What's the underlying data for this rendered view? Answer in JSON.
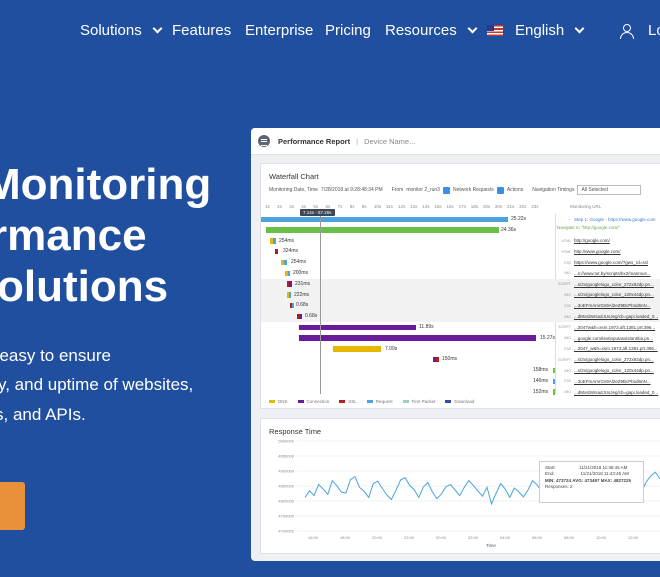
{
  "nav": {
    "items": [
      {
        "label": "Solutions",
        "has_dropdown": true
      },
      {
        "label": "Features",
        "has_dropdown": false
      },
      {
        "label": "Enterprise",
        "has_dropdown": false
      },
      {
        "label": "Pricing",
        "has_dropdown": false
      },
      {
        "label": "Resources",
        "has_dropdown": true
      }
    ],
    "language": "English",
    "login": "Log"
  },
  "hero": {
    "title_lines": [
      "Monitoring",
      "rmance",
      "olutions"
    ],
    "subtitle_lines": [
      "t easy to ensure",
      "y, and uptime of websites,",
      "s, and APIs."
    ]
  },
  "report": {
    "header_title": "Performance Report",
    "header_device": "Device Name...",
    "waterfall": {
      "title": "Waterfall Chart",
      "monitoring_date_label": "Monitoring Date, Time",
      "monitoring_date": "7/28/2018 at 9:28:48:34 PM",
      "from_label": "From",
      "from_value": "monitor 2_run3",
      "network_requests": "Network Requests",
      "actions": "Actions",
      "nav_timings_label": "Navigation Timings",
      "nav_timings_value": "All Selected",
      "monitoring_url_label": "Monitoring URL",
      "tick_labels": [
        "1s",
        "2s",
        "3s",
        "4s",
        "5s",
        "6s",
        "7s",
        "8s",
        "9s",
        "10s",
        "11s",
        "12s",
        "13s",
        "14s",
        "15s",
        "16s",
        "17s",
        "18s",
        "19s",
        "20s",
        "21s",
        "22s",
        "23s"
      ],
      "cursor_label": "7.14s - 57.26s",
      "rows": [
        {
          "label": "25.22s",
          "type": "",
          "url": "Step 1: Google - https://www.google.com",
          "kind": "step"
        },
        {
          "label": "24.36s",
          "type": "",
          "url": "Navigate to \"http://google.com/\"",
          "kind": "nav"
        },
        {
          "label": "254ms",
          "type": "HTML",
          "url": "http://google.com/",
          "kind": "url"
        },
        {
          "label": "324ms",
          "type": "HTML",
          "url": "http://www.google.com/",
          "kind": "url"
        },
        {
          "label": "254ms",
          "type": "CSS",
          "url": "https://www.google.com/?gws_rd=ssl",
          "kind": "url"
        },
        {
          "label": "200ms",
          "type": "IMG",
          "url": "...s://www.tut.by/scripts/bx2/manmus...",
          "kind": "url"
        },
        {
          "label": "231ms",
          "type": "SCRIPT",
          "url": "...s/2x/googlelogo_color_272x92dp.pn...",
          "kind": "url"
        },
        {
          "label": "222ms",
          "type": "IMG",
          "url": "...s/2x/googlelogo_color_120x44dp.pn...",
          "kind": "url"
        },
        {
          "label": "0.68s",
          "type": "CSS",
          "url": "...3oEFmAmrGs9Al2eZ9BcPbsd6nN...",
          "kind": "url"
        },
        {
          "label": "0.68s",
          "type": "IMG",
          "url": "...dMxsbWsadJUsJeg/cb=gapi.loaded_0...",
          "kind": "url"
        },
        {
          "label": "11.89s",
          "type": "SCRIPT",
          "url": "...2047w&h=xsm.1973.aft.1381.prt.396...",
          "kind": "url"
        },
        {
          "label": "15.27s",
          "type": "IMG",
          "url": "...google.com/textinputassistant/tia.pn...",
          "kind": "url"
        },
        {
          "label": "7.09s",
          "type": "CSS",
          "url": "...2047_w&h=xsm.1973.aft.1381.prt.396...",
          "kind": "url"
        },
        {
          "label": "150ms",
          "type": "SCRIPT",
          "url": "...s/2x/googlelogo_color_272x92dp.pn...",
          "kind": "url"
        },
        {
          "label": "158ms",
          "type": "IMG",
          "url": "...s/2x/googlelogo_color_120x44dp.pn...",
          "kind": "url"
        },
        {
          "label": "146ms",
          "type": "CSS",
          "url": "...3oEFmAmrGs9Al2eZ9BcPbsd6nN...",
          "kind": "url"
        },
        {
          "label": "152ms",
          "type": "IMG",
          "url": "...dMxsbWsadJUsJeg/cb=gapi.loaded_0...",
          "kind": "url"
        }
      ],
      "legend": [
        "DNS",
        "Connection",
        "SSL",
        "Request",
        "First Packet",
        "Download"
      ]
    },
    "response_time": {
      "title": "Response Time",
      "tooltip": {
        "start_label": "Start:",
        "start_value": "11/21/2018 11:38:45 AM",
        "end_label": "End:",
        "end_value": "11/21/2018 11:43:45 AM",
        "min": "MIN: 473724",
        "avg": "AVG: 473497",
        "max": "MAX: 4827225",
        "responses": "Responses: 2"
      }
    }
  },
  "chart_data": {
    "type": "line",
    "title": "Response Time",
    "xlabel": "Time",
    "ylabel": "",
    "x_tick_labels": [
      "16:00",
      "18:00",
      "20:00",
      "22:00",
      "00:00",
      "02:00",
      "04:00",
      "06:00",
      "08:00",
      "10:00",
      "12:00"
    ],
    "y_tick_labels": [
      "5000000",
      "4950000",
      "4900000",
      "4850000",
      "4800000",
      "4750000",
      "4700000"
    ],
    "ylim": [
      4700000,
      5000000
    ],
    "series": [
      {
        "color": "#4aa3df",
        "values": [
          4812000,
          4834000,
          4818000,
          4855000,
          4840000,
          4822000,
          4868000,
          4851000,
          4830000,
          4826000,
          4872000,
          4881000,
          4845000,
          4832000,
          4812000,
          4858000,
          4866000,
          4842000,
          4820000,
          4805000,
          4836000,
          4870000,
          4878000,
          4852000,
          4838000,
          4812000,
          4846000,
          4862000,
          4830000,
          4808000,
          4824000,
          4848000,
          4855000,
          4836000,
          4818000,
          4846000,
          4868000,
          4852000,
          4834000,
          4816000,
          4846000,
          4790000,
          4826000,
          4858000,
          4840000,
          4812000,
          4843000,
          4830000,
          4814000,
          4836000,
          4868000,
          4854000,
          4832000,
          4842000,
          4826000,
          4816000,
          4806000,
          4832000,
          4848000,
          4835000,
          4806000,
          4798000,
          4830000,
          4845000,
          4816000,
          4808000,
          4836000,
          4852000,
          4840000,
          4858000,
          4870000,
          4846000,
          4842000,
          4818000,
          4832000,
          4864000,
          4884000,
          4896000,
          4875000,
          4858000,
          4842000
        ]
      }
    ],
    "grid": true
  },
  "colors": {
    "background": "#1f4f9e",
    "cta": "#e8913a",
    "step_bar": "#4aa3df",
    "nav_bar": "#6abf4b",
    "dns": "#e6b800",
    "connection": "#6a1b9a",
    "ssl": "#b71c1c",
    "request": "#4aa3df",
    "first_packet": "#9ad1c9",
    "download": "#3949ab"
  }
}
